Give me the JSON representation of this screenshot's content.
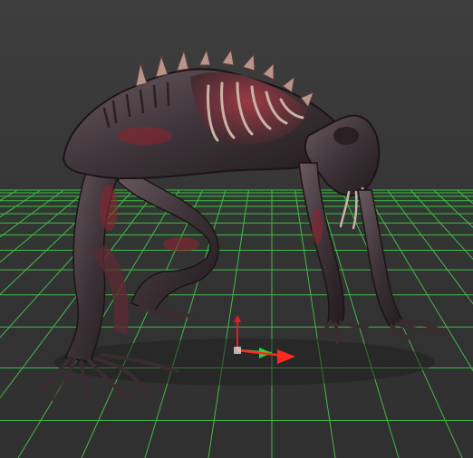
{
  "viewport": {
    "label": "",
    "background_color": "#3b3b3b",
    "ground_color": "#343434",
    "grid_color": "#45d24e",
    "gizmo": {
      "x_axis_color": "#ff2a1e",
      "y_axis_color": "#e02020",
      "z_axis_color": "#27d63a"
    },
    "model": {
      "icon": "creature-model",
      "skin_color": "#4a3f44",
      "flesh_color": "#8a2430",
      "bone_color": "#c9b3a6"
    }
  }
}
